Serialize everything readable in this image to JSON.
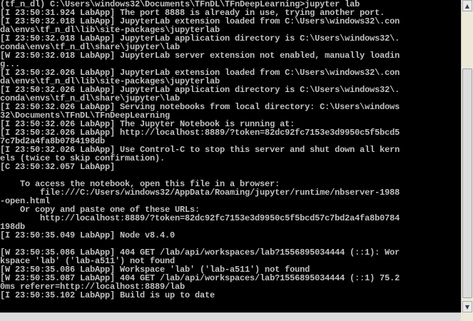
{
  "terminal": {
    "lines": [
      "(tf_n_dl) C:\\Users\\windows32\\Documents\\TFnDL\\TFnDeepLearning>jupyter lab",
      "[I 23:50:31.924 LabApp] The port 8888 is already in use, trying another port.",
      "[I 23:50:32.018 LabApp] JupyterLab extension loaded from C:\\Users\\windows32\\.con",
      "da\\envs\\tf_n_dl\\lib\\site-packages\\jupyterlab",
      "[I 23:50:32.018 LabApp] JupyterLab application directory is C:\\Users\\windows32\\.",
      "conda\\envs\\tf_n_dl\\share\\jupyter\\lab",
      "[W 23:50:32.018 LabApp] JupyterLab server extension not enabled, manually loadin",
      "g...",
      "[I 23:50:32.026 LabApp] JupyterLab extension loaded from C:\\Users\\windows32\\.con",
      "da\\envs\\tf_n_dl\\lib\\site-packages\\jupyterlab",
      "[I 23:50:32.026 LabApp] JupyterLab application directory is C:\\Users\\windows32\\.",
      "conda\\envs\\tf_n_dl\\share\\jupyter\\lab",
      "[I 23:50:32.026 LabApp] Serving notebooks from local directory: C:\\Users\\windows",
      "32\\Documents\\TFnDL\\TFnDeepLearning",
      "[I 23:50:32.026 LabApp] The Jupyter Notebook is running at:",
      "[I 23:50:32.026 LabApp] http://localhost:8889/?token=82dc92fc7153e3d9950c5f5bcd5",
      "7c7bd2a4fa8b0784198db",
      "[I 23:50:32.026 LabApp] Use Control-C to stop this server and shut down all kern",
      "els (twice to skip confirmation).",
      "[C 23:50:32.057 LabApp]",
      "",
      "    To access the notebook, open this file in a browser:",
      "        file:///C:/Users/windows32/AppData/Roaming/jupyter/runtime/nbserver-1988",
      "-open.html",
      "    Or copy and paste one of these URLs:",
      "        http://localhost:8889/?token=82dc92fc7153e3d9950c5f5bcd57c7bd2a4fa8b0784",
      "198db",
      "[I 23:50:35.049 LabApp] Node v8.4.0",
      "",
      "[W 23:50:35.086 LabApp] 404 GET /lab/api/workspaces/lab?1556895034444 (::1): Wor",
      "kspace 'lab' ('lab-a511') not found",
      "[W 23:50:35.086 LabApp] Workspace 'lab' ('lab-a511') not found",
      "[W 23:50:35.087 LabApp] 404 GET /lab/api/workspaces/lab?1556895034444 (::1) 75.2",
      "0ms referer=http://localhost:8889/lab",
      "[I 23:50:35.102 LabApp] Build is up to date"
    ]
  },
  "scrollbar": {
    "up_arrow": "▲",
    "down_arrow": "▼"
  }
}
